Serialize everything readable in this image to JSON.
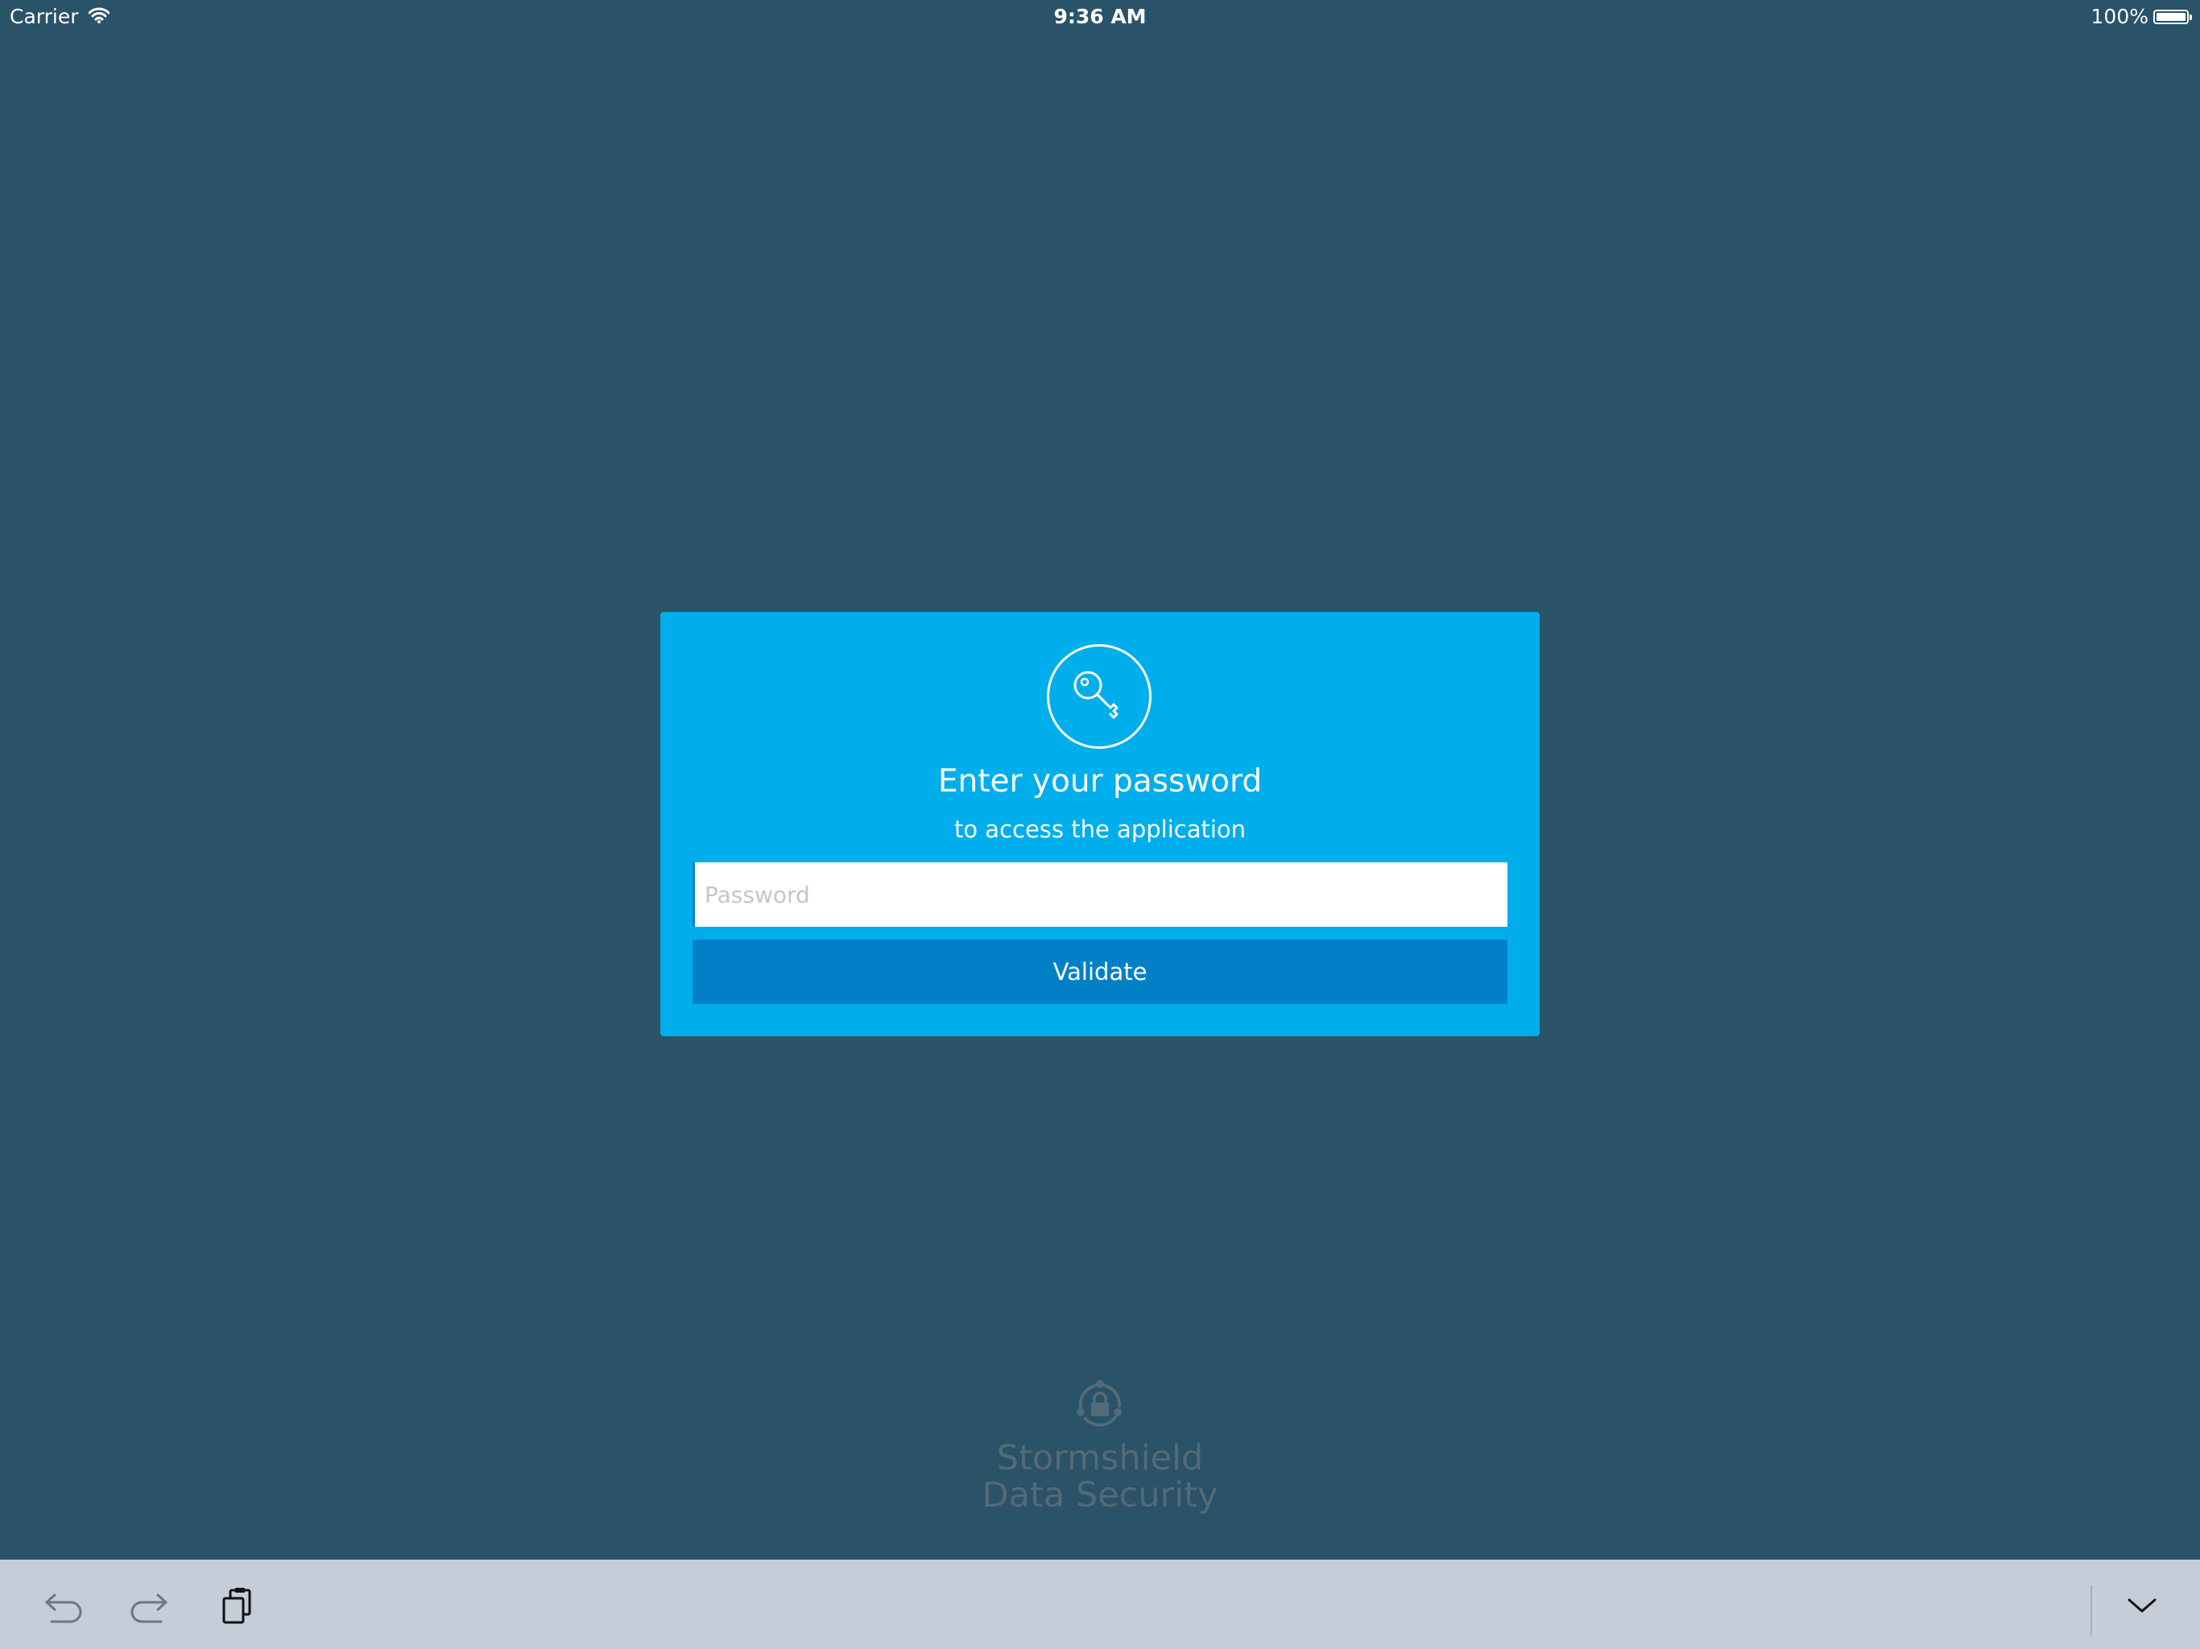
{
  "status_bar": {
    "carrier": "Carrier",
    "time": "9:36 AM",
    "battery": "100%"
  },
  "login": {
    "icon": "key-icon",
    "title": "Enter your password",
    "subtitle": "to access the application",
    "password_placeholder": "Password",
    "password_value": "",
    "validate_label": "Validate"
  },
  "brand": {
    "logo_icon": "lock-cycle-icon",
    "line1": "Stormshield",
    "line2": "Data Security"
  },
  "shortcut_bar": {
    "icons": [
      "undo-icon",
      "redo-icon",
      "paste-icon",
      "dismiss-keyboard-icon"
    ]
  },
  "colors": {
    "background": "#2a5268",
    "card": "#00aeec",
    "button": "#0180c8",
    "brand_text": "#536a77",
    "shortcut_bar": "#c5cdd8"
  }
}
